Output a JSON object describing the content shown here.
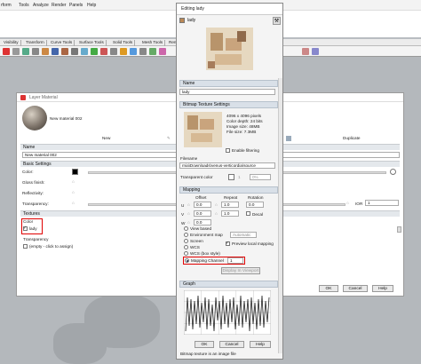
{
  "menubar": {
    "items": [
      "rform",
      "Tools",
      "Analyze",
      "Render",
      "Panels",
      "Help"
    ]
  },
  "tabs": [
    "Visibility",
    "Transform",
    "Curve Tools",
    "Surface Tools",
    "Solid Tools",
    "Mesh Tools",
    "Render"
  ],
  "layer_material": {
    "title": "Layer Material",
    "preview_name": "New material 002",
    "new_label": "New",
    "duplicate_label": "Duplicate",
    "name_header": "Name",
    "name_value": "New material 002",
    "basic_header": "Basic Settings",
    "color_label": "Color:",
    "gloss_label": "Gloss finish:",
    "reflectivity_label": "Reflectivity:",
    "transparency_label": "Transparency:",
    "ior_label": "IOR",
    "ior_value": "1",
    "textures_header": "Textures",
    "color_tex_label": "Color",
    "color_tex_value": "lady",
    "transparency_tex_label": "Transparency",
    "transparency_tex_value": "(empty - click to assign)",
    "ok_label": "OK",
    "cancel_label": "Cancel",
    "help_label": "Help"
  },
  "edit_dialog": {
    "title": "Editing lady",
    "texture_name": "lady",
    "name_header": "Name",
    "name_value": "lady",
    "bitmap_header": "Bitmap Texture Settings",
    "info_lines": [
      "4096 x 4096 pixels",
      "Color depth: 24 bits",
      "Image size: 48MB",
      "File size: 7.3MB"
    ],
    "enable_filtering_label": "Enable filtering",
    "filename_label": "Filename",
    "filename_value": "rnia\\Downloads\\venus-verticordia\\source",
    "transparent_color_label": "Transparent color",
    "transparent_value": "1",
    "transparent_pct": "0%",
    "mapping_header": "Mapping",
    "offset_label": "Offset",
    "repeat_label": "Repeat",
    "rotation_label": "Rotation",
    "u_label": "U",
    "v_label": "V",
    "w_label": "W",
    "u_offset": "0.0",
    "u_repeat": "1.0",
    "u_rotation": "0.0",
    "v_offset": "0.0",
    "v_repeat": "1.0",
    "v_rotation": "0.0",
    "decal_label": "Decal",
    "view_based_label": "View based",
    "env_map_label": "Environment map",
    "automatic_value": "Automatic",
    "screen_label": "Screen",
    "preview_local_label": "Preview local mapping",
    "wcs_label": "WCS",
    "wcs_box_label": "WCS (box style)",
    "mapping_channel_label": "Mapping Channel",
    "mapping_channel_value": "1",
    "display_viewport_label": "Display In Viewport",
    "graph_header": "Graph",
    "ok_label": "OK",
    "cancel_label": "Cancel",
    "help_label": "Help",
    "status_text": "Bitmap texture is an image file"
  }
}
